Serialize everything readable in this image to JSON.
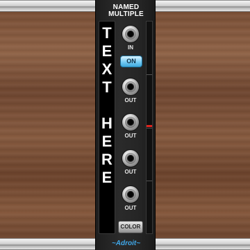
{
  "module": {
    "title_line1": "NAMED",
    "title_line2": "MULTIPLE",
    "name_letters": [
      "T",
      "E",
      "X",
      "T",
      "",
      "H",
      "E",
      "R",
      "E"
    ],
    "brand": "~Adroit~"
  },
  "controls": {
    "input_label": "IN",
    "on_button_label": "ON",
    "on_button_active": true,
    "outputs": [
      "OUT",
      "OUT",
      "OUT",
      "OUT"
    ],
    "color_button_label": "COLOR"
  },
  "colors": {
    "panel": "#262626",
    "button_on": "#6fc8f2",
    "indicator_marker": "#e0231d",
    "brand": "#3fa7e8"
  },
  "icons": {
    "jack": "audio-jack-icon"
  }
}
